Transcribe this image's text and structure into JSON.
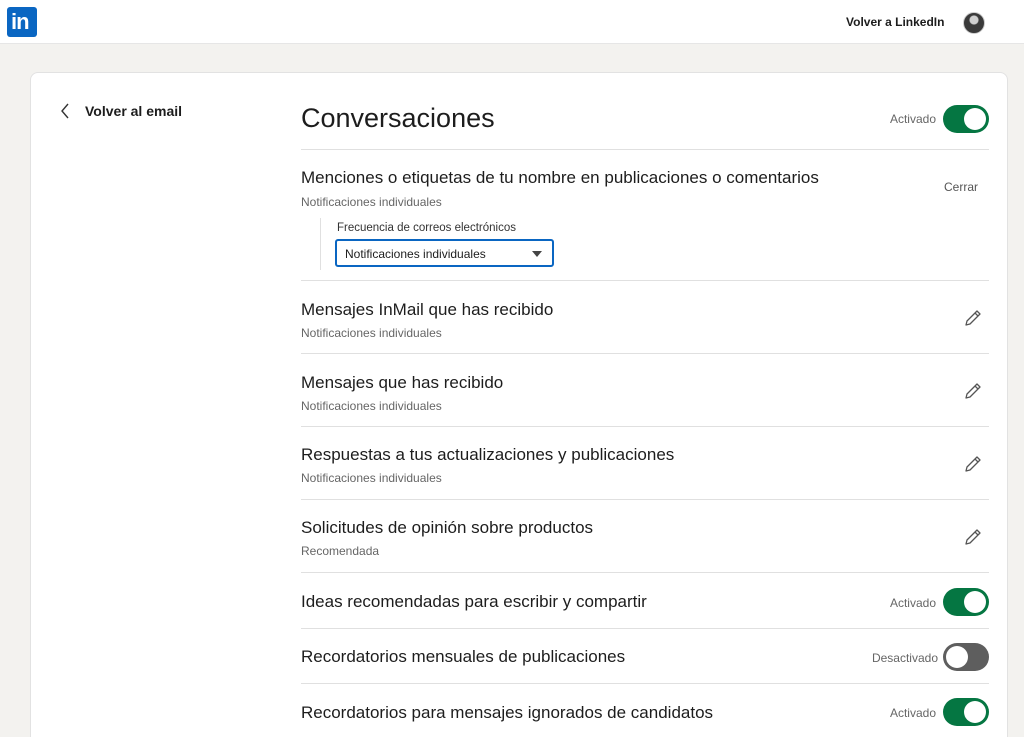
{
  "header": {
    "logo_text": "in",
    "back_to_linkedin": "Volver a LinkedIn"
  },
  "sidebar": {
    "back_label": "Volver al email"
  },
  "section": {
    "title": "Conversaciones",
    "status": "Activado",
    "enabled": true
  },
  "expanded_item": {
    "title": "Menciones o etiquetas de tu nombre en publicaciones o comentarios",
    "subtitle": "Notificaciones individuales",
    "close_label": "Cerrar",
    "frequency_label": "Frecuencia de correos electrónicos",
    "frequency_value": "Notificaciones individuales"
  },
  "items": [
    {
      "title": "Mensajes InMail que has recibido",
      "subtitle": "Notificaciones individuales"
    },
    {
      "title": "Mensajes que has recibido",
      "subtitle": "Notificaciones individuales"
    },
    {
      "title": "Respuestas a tus actualizaciones y publicaciones",
      "subtitle": "Notificaciones individuales"
    },
    {
      "title": "Solicitudes de opinión sobre productos",
      "subtitle": "Recomendada"
    }
  ],
  "toggle_items": [
    {
      "title": "Ideas recomendadas para escribir y compartir",
      "status": "Activado",
      "enabled": true
    },
    {
      "title": "Recordatorios mensuales de publicaciones",
      "status": "Desactivado",
      "enabled": false
    },
    {
      "title": "Recordatorios para mensajes ignorados de candidatos",
      "status": "Activado",
      "enabled": true
    }
  ],
  "colors": {
    "brand": "#0a66c2",
    "toggle_on": "#057642",
    "toggle_off": "#5e5e5e"
  }
}
